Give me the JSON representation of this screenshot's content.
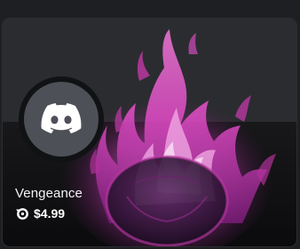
{
  "item": {
    "name": "Vengeance",
    "price": "$4.99",
    "avatar_icon": "discord-logo-icon",
    "currency_icon": "orb-icon"
  },
  "colors": {
    "page_bg": "#1e1f22",
    "banner_bg": "#2b2c30",
    "avatar_bg": "#4e5058",
    "flame_primary": "#e040c8",
    "flame_secondary": "#b23aa0",
    "text": "#f2f3f5"
  }
}
